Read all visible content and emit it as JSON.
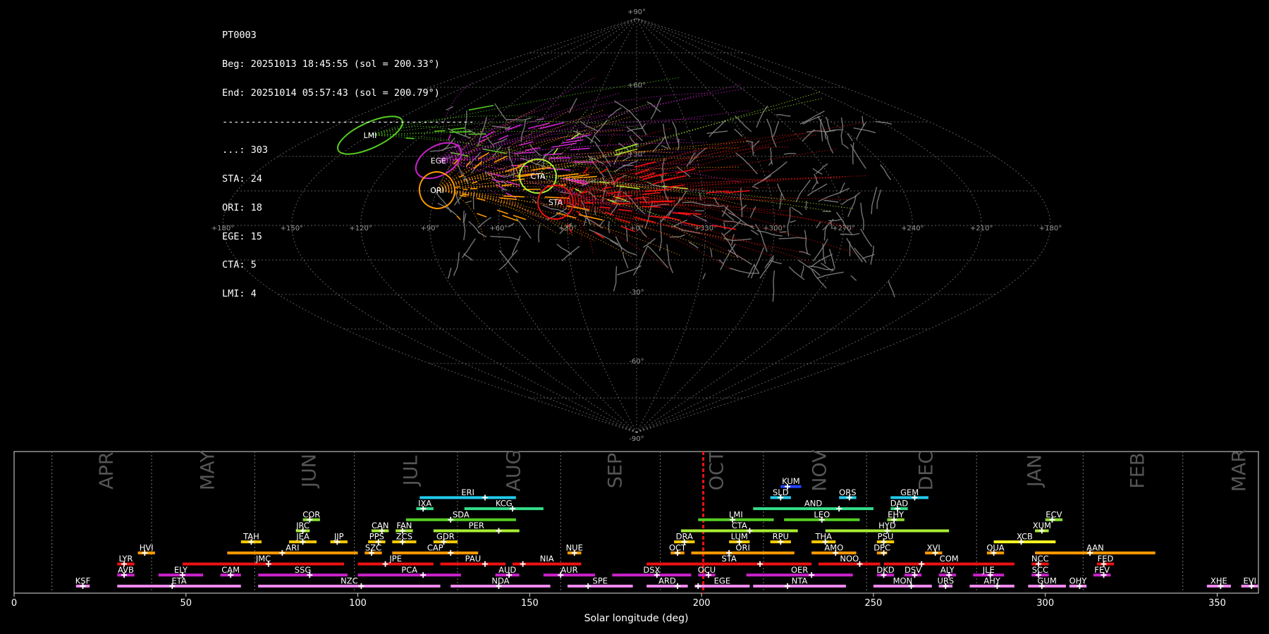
{
  "info": {
    "lines": [
      "PT0003",
      "Beg: 20251013 18:45:55 (sol = 200.33°)",
      "End: 20251014 05:57:43 (sol = 200.79°)",
      "--------------------------------------------",
      "...: 303",
      "STA: 24",
      "ORI: 18",
      "EGE: 15",
      "CTA: 5",
      "LMI: 4"
    ]
  },
  "sky_map": {
    "projection": "sinusoidal",
    "lon_labels": [
      "+180°",
      "+150°",
      "+120°",
      "+90°",
      "+60°",
      "+30°",
      "+0°",
      "+330°",
      "+300°",
      "+270°",
      "+240°",
      "+210°",
      "+180°"
    ],
    "lat_labels": [
      "+90°",
      "+60°",
      "+30°",
      "-30°",
      "-60°",
      "-90°"
    ],
    "grid": true,
    "radiant_labels": [
      {
        "name": "LMI",
        "color": "#55cc22"
      },
      {
        "name": "EGE",
        "color": "#cc22cc"
      },
      {
        "name": "ORI",
        "color": "#ff9900"
      },
      {
        "name": "CTA",
        "color": "#aaee33"
      },
      {
        "name": "STA",
        "color": "#ee1111"
      }
    ],
    "colors": {
      "sporadic": "#888888",
      "grid": "#aaaaaa"
    }
  },
  "chart_data": {
    "type": "bar",
    "xlabel": "Solar longitude (deg)",
    "xlim": [
      0,
      362
    ],
    "xticks": [
      0,
      50,
      100,
      150,
      200,
      250,
      300,
      350
    ],
    "current_sol": 200.5,
    "current_sol_color": "#ee1111",
    "months": [
      {
        "name": "APR",
        "start": 11
      },
      {
        "name": "MAY",
        "start": 40
      },
      {
        "name": "JUN",
        "start": 70
      },
      {
        "name": "JUL",
        "start": 99
      },
      {
        "name": "AUG",
        "start": 129
      },
      {
        "name": "SEP",
        "start": 159
      },
      {
        "name": "OCT",
        "start": 188
      },
      {
        "name": "NOV",
        "start": 218
      },
      {
        "name": "DEC",
        "start": 248
      },
      {
        "name": "JAN",
        "start": 280
      },
      {
        "name": "FEB",
        "start": 311
      },
      {
        "name": "MAR",
        "start": 340
      }
    ],
    "showers": [
      {
        "name": "KSF",
        "s": 18,
        "e": 22,
        "p": 20,
        "row": 0,
        "color": "#ee88ee"
      },
      {
        "name": "ETA",
        "s": 30,
        "e": 66,
        "p": 46,
        "row": 0,
        "color": "#ee88ee"
      },
      {
        "name": "NZC",
        "s": 71,
        "e": 124,
        "p": 101,
        "row": 0,
        "color": "#ee88ee"
      },
      {
        "name": "NDA",
        "s": 127,
        "e": 156,
        "p": 141,
        "row": 0,
        "color": "#ee88ee"
      },
      {
        "name": "SPE",
        "s": 161,
        "e": 180,
        "p": 167,
        "row": 0,
        "color": "#ee88ee"
      },
      {
        "name": "ARD",
        "s": 184,
        "e": 196,
        "p": 193,
        "row": 0,
        "color": "#ee88ee"
      },
      {
        "name": "EGE",
        "s": 198,
        "e": 214,
        "p": 199,
        "row": 0,
        "color": "#ee88ee"
      },
      {
        "name": "NTA",
        "s": 215,
        "e": 242,
        "p": 225,
        "row": 0,
        "color": "#ee88ee"
      },
      {
        "name": "MON",
        "s": 250,
        "e": 267,
        "p": 261,
        "row": 0,
        "color": "#ee88ee"
      },
      {
        "name": "URS",
        "s": 269,
        "e": 273,
        "p": 271,
        "row": 0,
        "color": "#ee88ee"
      },
      {
        "name": "AHY",
        "s": 278,
        "e": 291,
        "p": 286,
        "row": 0,
        "color": "#ee88ee"
      },
      {
        "name": "GUM",
        "s": 295,
        "e": 306,
        "p": 299,
        "row": 0,
        "color": "#ee88ee"
      },
      {
        "name": "OHY",
        "s": 307,
        "e": 312,
        "p": 310,
        "row": 0,
        "color": "#ee88ee"
      },
      {
        "name": "XHE",
        "s": 347,
        "e": 354,
        "p": 351,
        "row": 0,
        "color": "#ee88ee"
      },
      {
        "name": "EVI",
        "s": 357,
        "e": 362,
        "p": 360,
        "row": 0,
        "color": "#ee88ee"
      },
      {
        "name": "AVB",
        "s": 30,
        "e": 35,
        "p": 32,
        "row": 1,
        "color": "#cc22cc"
      },
      {
        "name": "ELY",
        "s": 42,
        "e": 55,
        "p": 49,
        "row": 1,
        "color": "#cc22cc"
      },
      {
        "name": "CAM",
        "s": 60,
        "e": 66,
        "p": 63,
        "row": 1,
        "color": "#cc22cc"
      },
      {
        "name": "SSG",
        "s": 71,
        "e": 97,
        "p": 86,
        "row": 1,
        "color": "#cc22cc"
      },
      {
        "name": "PCA",
        "s": 100,
        "e": 130,
        "p": 119,
        "row": 1,
        "color": "#cc22cc"
      },
      {
        "name": "AUD",
        "s": 140,
        "e": 147,
        "p": 144,
        "row": 1,
        "color": "#cc22cc"
      },
      {
        "name": "AUR",
        "s": 154,
        "e": 169,
        "p": 159,
        "row": 1,
        "color": "#cc22cc"
      },
      {
        "name": "DSX",
        "s": 174,
        "e": 197,
        "p": 187,
        "row": 1,
        "color": "#cc22cc"
      },
      {
        "name": "OCU",
        "s": 199,
        "e": 204,
        "p": 202,
        "row": 1,
        "color": "#cc22cc"
      },
      {
        "name": "OER",
        "s": 213,
        "e": 244,
        "p": 232,
        "row": 1,
        "color": "#cc22cc"
      },
      {
        "name": "DKD",
        "s": 251,
        "e": 256,
        "p": 253,
        "row": 1,
        "color": "#cc22cc"
      },
      {
        "name": "DSV",
        "s": 259,
        "e": 264,
        "p": 262,
        "row": 1,
        "color": "#cc22cc"
      },
      {
        "name": "ALY",
        "s": 269,
        "e": 274,
        "p": 272,
        "row": 1,
        "color": "#cc22cc"
      },
      {
        "name": "JLE",
        "s": 279,
        "e": 288,
        "p": 284,
        "row": 1,
        "color": "#cc22cc"
      },
      {
        "name": "SCC",
        "s": 296,
        "e": 301,
        "p": 298,
        "row": 1,
        "color": "#cc22cc"
      },
      {
        "name": "FEV",
        "s": 314,
        "e": 319,
        "p": 317,
        "row": 1,
        "color": "#cc22cc"
      },
      {
        "name": "LYR",
        "s": 30,
        "e": 35,
        "p": 32,
        "row": 2,
        "color": "#ee1111"
      },
      {
        "name": "JMC",
        "s": 49,
        "e": 96,
        "p": 74,
        "row": 2,
        "color": "#ee1111"
      },
      {
        "name": "JPE",
        "s": 100,
        "e": 122,
        "p": 108,
        "row": 2,
        "color": "#ee1111"
      },
      {
        "name": "PAU",
        "s": 124,
        "e": 143,
        "p": 137,
        "row": 2,
        "color": "#ee1111"
      },
      {
        "name": "NIA",
        "s": 145,
        "e": 165,
        "p": 148,
        "row": 2,
        "color": "#ee1111"
      },
      {
        "name": "STA",
        "s": 184,
        "e": 232,
        "p": 217,
        "row": 2,
        "color": "#ee1111"
      },
      {
        "name": "NOO",
        "s": 234,
        "e": 252,
        "p": 246,
        "row": 2,
        "color": "#ee1111"
      },
      {
        "name": "COM",
        "s": 253,
        "e": 291,
        "p": 264,
        "row": 2,
        "color": "#ee1111"
      },
      {
        "name": "NCC",
        "s": 296,
        "e": 301,
        "p": 298,
        "row": 2,
        "color": "#ee1111"
      },
      {
        "name": "FED",
        "s": 315,
        "e": 320,
        "p": 317,
        "row": 2,
        "color": "#ee1111"
      },
      {
        "name": "HVI",
        "s": 36,
        "e": 41,
        "p": 38,
        "row": 3,
        "color": "#ff9900"
      },
      {
        "name": "ARI",
        "s": 62,
        "e": 100,
        "p": 78,
        "row": 3,
        "color": "#ff9900"
      },
      {
        "name": "SZC",
        "s": 102,
        "e": 107,
        "p": 104,
        "row": 3,
        "color": "#ff9900"
      },
      {
        "name": "CAP",
        "s": 110,
        "e": 135,
        "p": 127,
        "row": 3,
        "color": "#ff9900"
      },
      {
        "name": "NUE",
        "s": 161,
        "e": 165,
        "p": 163,
        "row": 3,
        "color": "#ff9900"
      },
      {
        "name": "OCT",
        "s": 191,
        "e": 195,
        "p": 193,
        "row": 3,
        "color": "#ff9900"
      },
      {
        "name": "ORI",
        "s": 197,
        "e": 227,
        "p": 208,
        "row": 3,
        "color": "#ff9900"
      },
      {
        "name": "AMO",
        "s": 232,
        "e": 245,
        "p": 239,
        "row": 3,
        "color": "#ff9900"
      },
      {
        "name": "DPC",
        "s": 251,
        "e": 254,
        "p": 253,
        "row": 3,
        "color": "#ff9900"
      },
      {
        "name": "XVI",
        "s": 265,
        "e": 270,
        "p": 268,
        "row": 3,
        "color": "#ff9900"
      },
      {
        "name": "QUA",
        "s": 283,
        "e": 288,
        "p": 285,
        "row": 3,
        "color": "#ff9900"
      },
      {
        "name": "AAN",
        "s": 297,
        "e": 332,
        "p": 313,
        "row": 3,
        "color": "#ff9900"
      },
      {
        "name": "TAH",
        "s": 66,
        "e": 72,
        "p": 69,
        "row": 4,
        "color": "#ffcc00"
      },
      {
        "name": "JEA",
        "s": 80,
        "e": 88,
        "p": 84,
        "row": 4,
        "color": "#ffcc00"
      },
      {
        "name": "JIP",
        "s": 92,
        "e": 97,
        "p": 94,
        "row": 4,
        "color": "#ffcc00"
      },
      {
        "name": "PPS",
        "s": 103,
        "e": 108,
        "p": 106,
        "row": 4,
        "color": "#ffcc00"
      },
      {
        "name": "ZCS",
        "s": 110,
        "e": 117,
        "p": 113,
        "row": 4,
        "color": "#ffcc00"
      },
      {
        "name": "GDR",
        "s": 122,
        "e": 129,
        "p": 125,
        "row": 4,
        "color": "#ffcc00"
      },
      {
        "name": "DRA",
        "s": 192,
        "e": 198,
        "p": 195,
        "row": 4,
        "color": "#ffcc00"
      },
      {
        "name": "LUM",
        "s": 208,
        "e": 214,
        "p": 211,
        "row": 4,
        "color": "#ffcc00"
      },
      {
        "name": "RPU",
        "s": 220,
        "e": 226,
        "p": 223,
        "row": 4,
        "color": "#ffcc00"
      },
      {
        "name": "THA",
        "s": 232,
        "e": 239,
        "p": 236,
        "row": 4,
        "color": "#ffcc00"
      },
      {
        "name": "PSU",
        "s": 251,
        "e": 256,
        "p": 253,
        "row": 4,
        "color": "#ffcc00"
      },
      {
        "name": "XCB",
        "s": 285,
        "e": 303,
        "p": 293,
        "row": 4,
        "color": "#ffff22"
      },
      {
        "name": "JRC",
        "s": 82,
        "e": 86,
        "p": 84,
        "row": 5,
        "color": "#aaee33"
      },
      {
        "name": "CAN",
        "s": 104,
        "e": 109,
        "p": 107,
        "row": 5,
        "color": "#aaee33"
      },
      {
        "name": "FAN",
        "s": 111,
        "e": 116,
        "p": 113,
        "row": 5,
        "color": "#aaee33"
      },
      {
        "name": "PER",
        "s": 122,
        "e": 147,
        "p": 141,
        "row": 5,
        "color": "#aaee33"
      },
      {
        "name": "CTA",
        "s": 194,
        "e": 228,
        "p": 214,
        "row": 5,
        "color": "#aaee33"
      },
      {
        "name": "HYD",
        "s": 236,
        "e": 272,
        "p": 254,
        "row": 5,
        "color": "#aaee33"
      },
      {
        "name": "XUM",
        "s": 297,
        "e": 301,
        "p": 299,
        "row": 5,
        "color": "#aaee33"
      },
      {
        "name": "COR",
        "s": 84,
        "e": 89,
        "p": 86,
        "row": 6,
        "color": "#88dd33"
      },
      {
        "name": "SDA",
        "s": 114,
        "e": 146,
        "p": 127,
        "row": 6,
        "color": "#55cc22"
      },
      {
        "name": "LMI",
        "s": 199,
        "e": 221,
        "p": 209,
        "row": 6,
        "color": "#55cc22"
      },
      {
        "name": "LEO",
        "s": 224,
        "e": 246,
        "p": 235,
        "row": 6,
        "color": "#55cc22"
      },
      {
        "name": "EHY",
        "s": 254,
        "e": 259,
        "p": 256,
        "row": 6,
        "color": "#88dd33"
      },
      {
        "name": "ECV",
        "s": 300,
        "e": 305,
        "p": 302,
        "row": 6,
        "color": "#88dd33"
      },
      {
        "name": "IXA",
        "s": 117,
        "e": 122,
        "p": 119,
        "row": 7,
        "color": "#33dd88"
      },
      {
        "name": "KCG",
        "s": 131,
        "e": 154,
        "p": 145,
        "row": 7,
        "color": "#33dd88"
      },
      {
        "name": "AND",
        "s": 215,
        "e": 250,
        "p": 240,
        "row": 7,
        "color": "#33dd88"
      },
      {
        "name": "DAD",
        "s": 255,
        "e": 260,
        "p": 257,
        "row": 7,
        "color": "#33dd88"
      },
      {
        "name": "ERI",
        "s": 118,
        "e": 146,
        "p": 137,
        "row": 8,
        "color": "#22ccee"
      },
      {
        "name": "SLD",
        "s": 220,
        "e": 226,
        "p": 223,
        "row": 8,
        "color": "#22ccee"
      },
      {
        "name": "ORS",
        "s": 240,
        "e": 245,
        "p": 243,
        "row": 8,
        "color": "#22ccee"
      },
      {
        "name": "GEM",
        "s": 255,
        "e": 266,
        "p": 262,
        "row": 8,
        "color": "#22ccee"
      },
      {
        "name": "KUM",
        "s": 223,
        "e": 229,
        "p": 225,
        "row": 9,
        "color": "#2244ff"
      }
    ]
  }
}
